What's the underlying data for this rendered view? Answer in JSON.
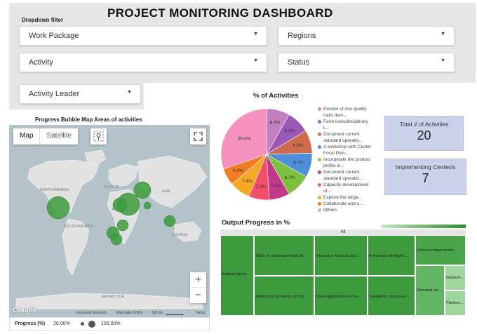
{
  "dashboard": {
    "title": "PROJECT MONITORING DASHBOARD"
  },
  "filters": {
    "label": "Dropdown filter",
    "work_package": "Work Package",
    "regions": "Regions",
    "activity": "Activity",
    "status": "Status",
    "activity_leader": "Activity Leader"
  },
  "map": {
    "title": "Progress Bubble Map Areas of activities",
    "map_label": "Map",
    "satellite_label": "Satellite",
    "zoom_in": "+",
    "zoom_out": "−",
    "region_labels": [
      "NORTH AMERICA",
      "SOUTH AMERICA",
      "EUROPE",
      "AFRICA",
      "ASIA",
      "OCEANIA",
      "ANTARCTICA"
    ],
    "footer": {
      "logo": "Google",
      "shortcuts": "Keyboard shortcuts",
      "map_data": "Map data ©2024",
      "scale": "500 km",
      "terms": "Terms"
    },
    "colors": {
      "water": "#b3c3c9",
      "land": "#e2e2e2",
      "bubble": "#3d9b3d"
    }
  },
  "progress_legend": {
    "label": "Progress (%)",
    "min": "20.00%",
    "max": "100.00%"
  },
  "pie": {
    "title": "% of Activities",
    "legend": [
      {
        "label": "Review of rice quality traits dem...",
        "color": "#e983b8"
      },
      {
        "label": "Form transdisciplinary t...",
        "color": "#a05ec0"
      },
      {
        "label": "Document current standard operatio...",
        "color": "#d66c50"
      },
      {
        "label": "A workshop with Center Focal Poin...",
        "color": "#4f8fd9"
      },
      {
        "label": "Incorporate the product profile in...",
        "color": "#8bc34a"
      },
      {
        "label": "Document current standard operatio...",
        "color": "#b9418f"
      },
      {
        "label": "Capacity development of...",
        "color": "#f26262"
      },
      {
        "label": "Explore the targe...",
        "color": "#f7a823"
      },
      {
        "label": "Collaborate and c...",
        "color": "#f27b23"
      },
      {
        "label": "Others",
        "color": "#f59fc6"
      }
    ]
  },
  "chart_data": {
    "type": "pie",
    "title": "% of Activities",
    "slices": [
      {
        "label": "Review of rice quality traits dem...",
        "value": 8.3,
        "color": "#c47fc0"
      },
      {
        "label": "Form transdisciplinary t...",
        "value": 8.3,
        "color": "#9b59b6"
      },
      {
        "label": "Document current standard operatio...",
        "value": 8.3,
        "color": "#cf6a4c"
      },
      {
        "label": "A workshop with Center Focal Poin...",
        "value": 8.7,
        "color": "#4f8fd9"
      },
      {
        "label": "Incorporate the product profile in...",
        "value": 8.7,
        "color": "#7dbf3e"
      },
      {
        "label": "Document current standard operatio...",
        "value": 7.4,
        "color": "#c2398c"
      },
      {
        "label": "Capacity development of...",
        "value": 7.4,
        "color": "#f24e6a"
      },
      {
        "label": "Explore the targe...",
        "value": 7.4,
        "color": "#f7a823"
      },
      {
        "label": "Collaborate and c...",
        "value": 6.2,
        "color": "#f27b23"
      },
      {
        "label": "Others",
        "value": 30.6,
        "color": "#f591bd"
      }
    ],
    "value_labels": [
      "8.3%",
      "8.3%",
      "8.3%",
      "8.7%",
      "8.7%",
      "7.4%",
      "7.4%",
      "7.4%",
      "6.2%",
      "30.6%"
    ]
  },
  "scorecards": {
    "total_activities_label": "Total # of Activities",
    "total_activities_value": "20",
    "centers_label": "Implementing Center/s",
    "centers_value": "7"
  },
  "treemap": {
    "title": "Output Progress in %",
    "header": "All",
    "cells": [
      {
        "label": "Address gend..."
      },
      {
        "label": "Study to understand how Mi..."
      },
      {
        "label": "Advancing the design of inst..."
      },
      {
        "label": "Innovative methods and..."
      },
      {
        "label": "Novel applications of me..."
      },
      {
        "label": "Behavioral intelligenc..."
      },
      {
        "label": "Standards, structures,..."
      },
      {
        "label": "Inclusive target produ..."
      },
      {
        "label": "Standard op..."
      },
      {
        "label": "Global b..."
      },
      {
        "label": "Pipeline..."
      }
    ],
    "colors": {
      "dark": "#3d9b3d",
      "mid": "#62b562",
      "light": "#9ed69e",
      "scale_low": "#bfe6bf",
      "scale_high": "#2e8b2e"
    }
  }
}
